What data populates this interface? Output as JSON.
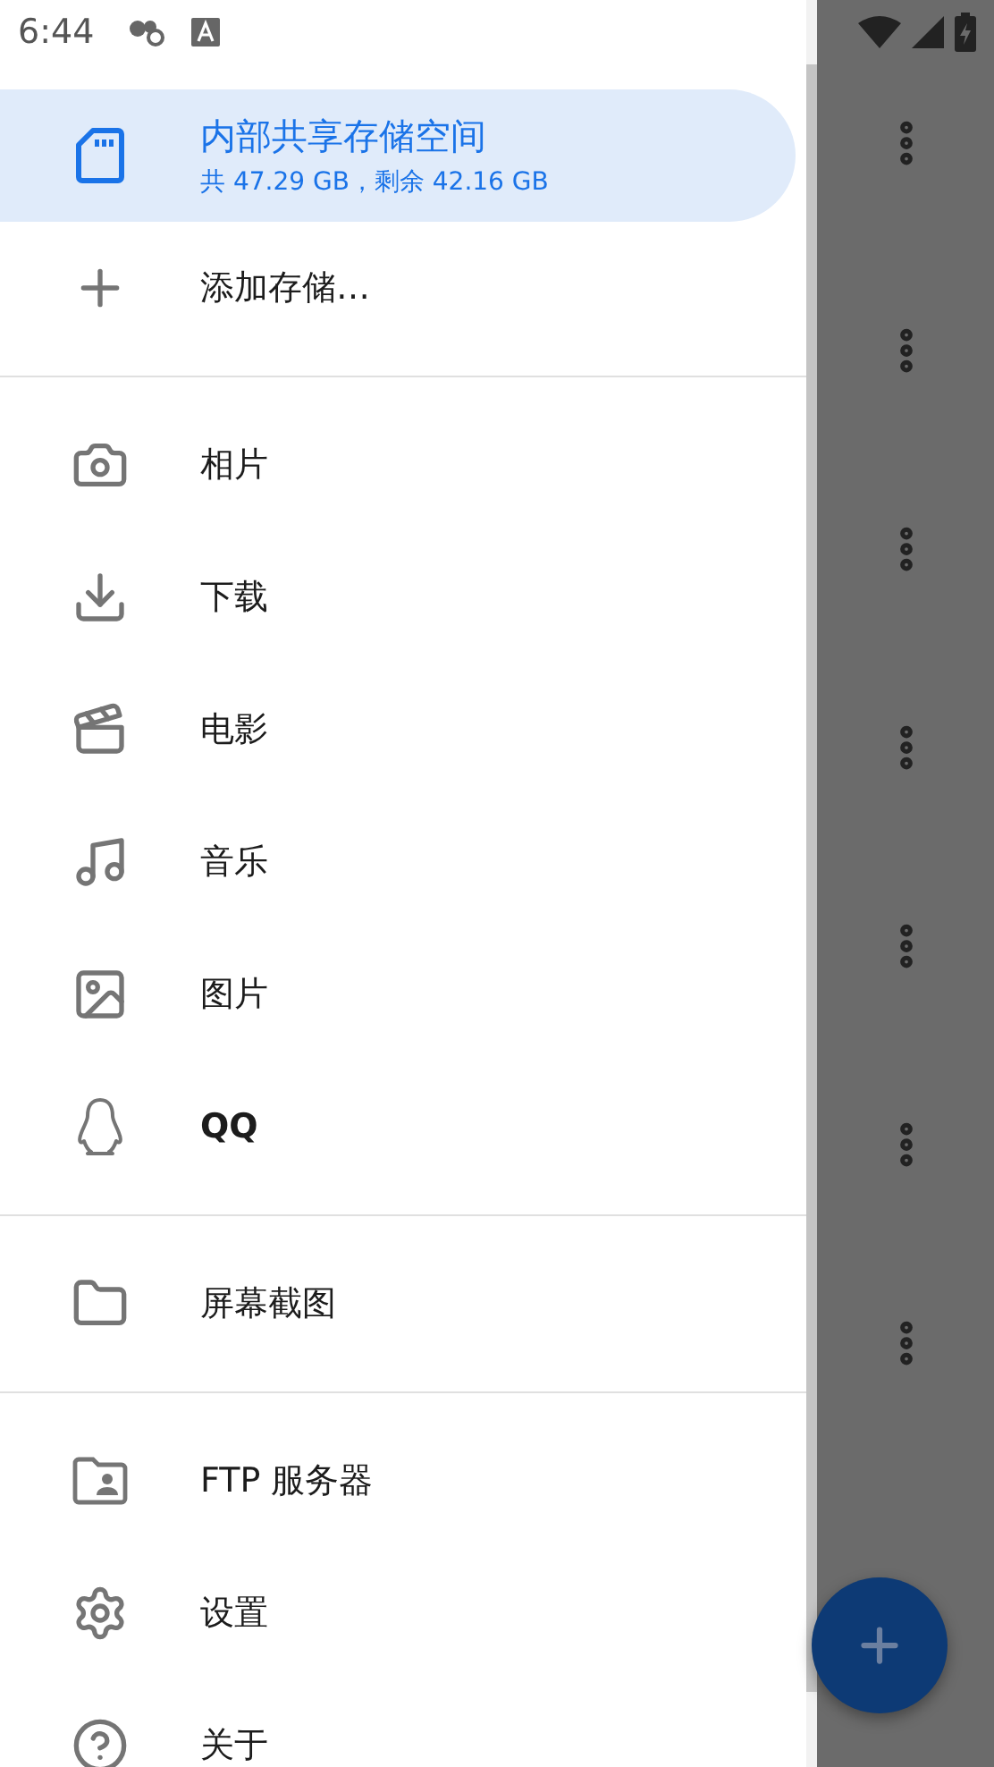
{
  "status_bar": {
    "time": "6:44"
  },
  "drawer": {
    "sections": [
      {
        "items": [
          {
            "kind": "sd",
            "label": "内部共享存储空间",
            "detail": "共 47.29 GB，剩余 42.16 GB",
            "selected": true
          },
          {
            "kind": "add",
            "label": "添加存储…",
            "selected": false
          }
        ]
      },
      {
        "items": [
          {
            "kind": "camera",
            "label": "相片",
            "selected": false
          },
          {
            "kind": "download",
            "label": "下载",
            "selected": false
          },
          {
            "kind": "movie",
            "label": "电影",
            "selected": false
          },
          {
            "kind": "music",
            "label": "音乐",
            "selected": false
          },
          {
            "kind": "image",
            "label": "图片",
            "selected": false
          },
          {
            "kind": "penguin",
            "label": "QQ",
            "selected": false
          }
        ]
      },
      {
        "items": [
          {
            "kind": "folder",
            "label": "屏幕截图",
            "selected": false
          }
        ]
      },
      {
        "items": [
          {
            "kind": "folderperson",
            "label": "FTP 服务器",
            "selected": false
          },
          {
            "kind": "gear",
            "label": "设置",
            "selected": false
          },
          {
            "kind": "help",
            "label": "关于",
            "selected": false
          }
        ]
      }
    ]
  }
}
